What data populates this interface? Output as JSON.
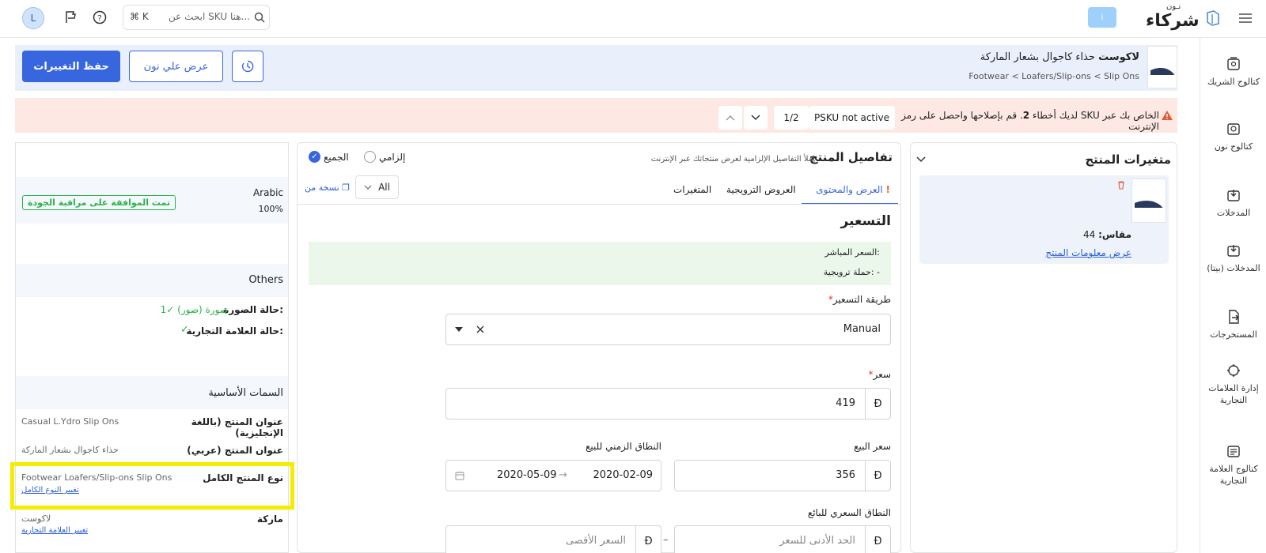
{
  "topbar": {
    "avatar_letter": "L",
    "search_placeholder": "ابحث عن SKU هنا...",
    "shortcut": "⌘ K",
    "brand_small": "نـون",
    "brand": "شركاء",
    "button_text": "i"
  },
  "sidenav": {
    "items": [
      {
        "label": "كتالوج الشريك"
      },
      {
        "label": "كتالوج نون"
      },
      {
        "label": "المدخلات"
      },
      {
        "label": "المدخلات (بيتا)"
      },
      {
        "label": "المستخرجات"
      },
      {
        "label": "إدارة العلامات التجارية"
      },
      {
        "label": "كتالوج العلامة التجارية"
      }
    ]
  },
  "product": {
    "brand": "لاكوست",
    "title": "حذاء كاجوال بشعار الماركة",
    "breadcrumb": "Footwear < Loafers/Slip-ons < Slip Ons",
    "save_label": "حفظ التغييرات",
    "view_label": "عرض علي نون"
  },
  "errors": {
    "text_prefix": "لديك أخطاء",
    "count": "2",
    "text_suffix": ". قم بإصلاحها واحصل على رمز SKU الخاص بك عبر الإنترنت",
    "status": "PSKU not active",
    "pager": "1/2"
  },
  "variants": {
    "title": "متغيرات المنتج",
    "size_label": "مقاس:",
    "size_value": "44",
    "link": "عرض معلومات المنتج"
  },
  "details": {
    "title": "تفاصيل المنتج",
    "subtitle": "املأ التفاصيل الإلزامية لعرض منتجاتك عبر الإنترنت",
    "radio_required": "إلزامي",
    "radio_all": "الجميع",
    "tabs": [
      "العرض والمحتوى",
      "العروض الترويجية",
      "المتغيرات"
    ],
    "filter_value": "All",
    "copy_from": "نسخة من"
  },
  "pricing": {
    "title": "التسعير",
    "live_price": "السعر المباشر:",
    "campaign": "حملة ترويجية: -",
    "method_label": "طريقة التسعير",
    "method_value": "Manual",
    "price_label": "سعر",
    "price_value": "419",
    "currency": "Đ",
    "sale_label": "سعر البيع",
    "sale_value": "356",
    "sale_range_label": "النطاق الزمني للبيع",
    "date_from": "2020-02-09",
    "date_to": "2020-05-09",
    "seller_range_label": "النطاق السعري للبائع",
    "min_placeholder": "الحد الأدنى للسعر",
    "max_placeholder": "السعر الأقصى"
  },
  "left": {
    "language": "Arabic",
    "percent": "100%",
    "qc_badge": "تمت الموافقة على مراقبة الجودة",
    "others": "Others",
    "image_status_label": "حالة الصورة:",
    "image_status_value": "1✓ صورة (صور)",
    "brand_status_label": "حالة العلامة التجارية:",
    "core_attrs": "السمات الأساسية",
    "rows": [
      {
        "label": "عنوان المنتج (باللغة الإنجليزية)",
        "value": "Casual L.Ydro Slip Ons"
      },
      {
        "label": "عنوان المنتج (عربي)",
        "value": "حذاء كاجوال بشعار الماركة"
      },
      {
        "label": "نوع المنتج الكامل",
        "value": "Footwear Loafers/Slip-ons Slip Ons",
        "link": "تغيير النوع الكامل"
      },
      {
        "label": "ماركة",
        "value": "لاكوست",
        "link": "تغيير العلامة التجارية"
      }
    ]
  },
  "colors": {
    "primary": "#3866df",
    "error_bg": "#fde8e3",
    "highlight": "#f5ec00",
    "success": "#2bb24c"
  }
}
